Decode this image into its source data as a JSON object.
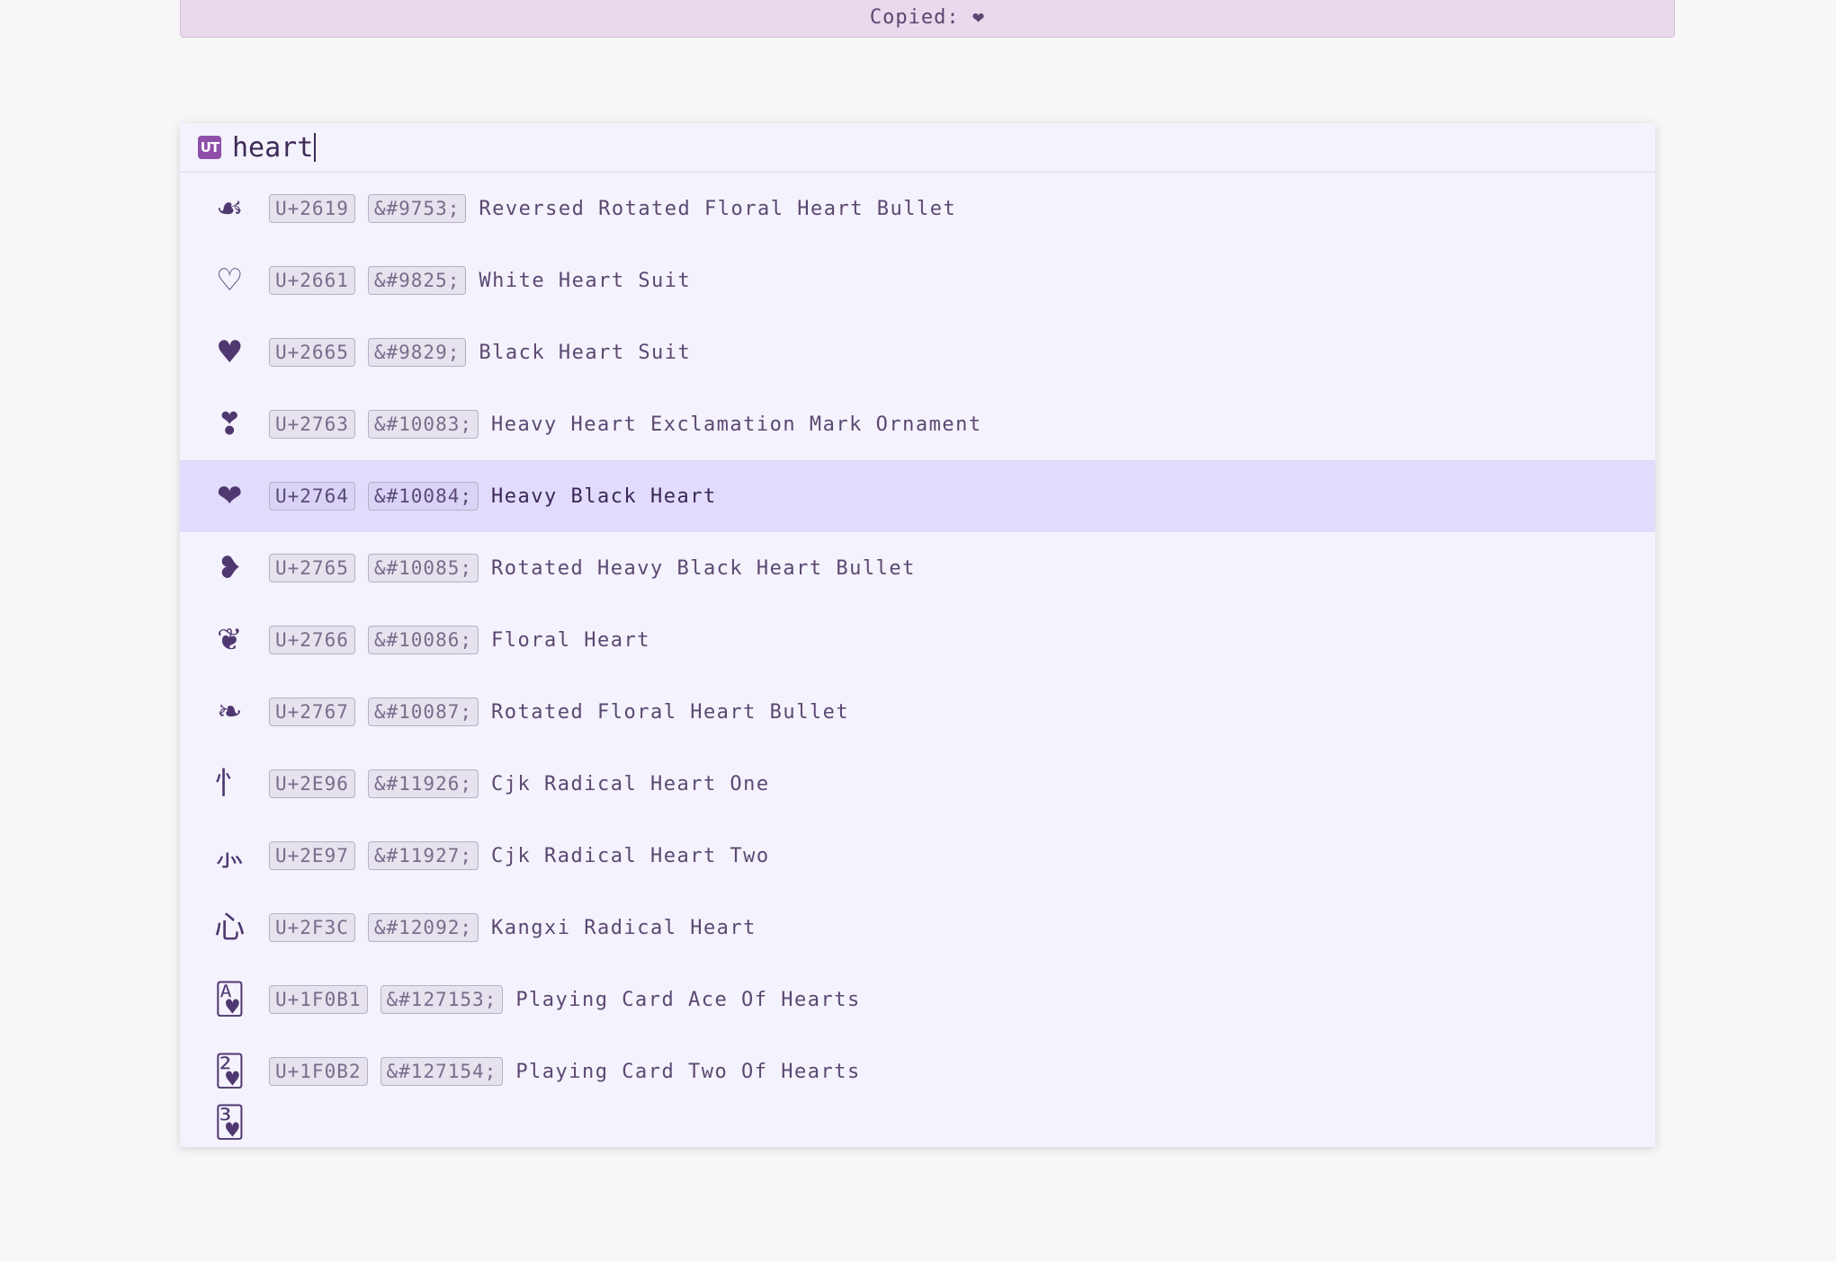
{
  "banner": {
    "label": "Copied:",
    "glyph": "❤"
  },
  "search": {
    "logo_text": "UT",
    "value": "heart"
  },
  "results": [
    {
      "glyph": "☙",
      "code": "U+2619",
      "entity": "&#9753;",
      "name": "Reversed Rotated Floral Heart Bullet"
    },
    {
      "glyph": "♡",
      "code": "U+2661",
      "entity": "&#9825;",
      "name": "White Heart Suit"
    },
    {
      "glyph": "♥",
      "code": "U+2665",
      "entity": "&#9829;",
      "name": "Black Heart Suit"
    },
    {
      "glyph": "❣",
      "code": "U+2763",
      "entity": "&#10083;",
      "name": "Heavy Heart Exclamation Mark Ornament"
    },
    {
      "glyph": "❤",
      "code": "U+2764",
      "entity": "&#10084;",
      "name": "Heavy Black Heart",
      "selected": true
    },
    {
      "glyph": "❥",
      "code": "U+2765",
      "entity": "&#10085;",
      "name": "Rotated Heavy Black Heart Bullet"
    },
    {
      "glyph": "❦",
      "code": "U+2766",
      "entity": "&#10086;",
      "name": "Floral Heart"
    },
    {
      "glyph": "❧",
      "code": "U+2767",
      "entity": "&#10087;",
      "name": "Rotated Floral Heart Bullet"
    },
    {
      "glyph": "⺖",
      "code": "U+2E96",
      "entity": "&#11926;",
      "name": "Cjk Radical Heart One"
    },
    {
      "glyph": "⺗",
      "code": "U+2E97",
      "entity": "&#11927;",
      "name": "Cjk Radical Heart Two"
    },
    {
      "glyph": "⼼",
      "code": "U+2F3C",
      "entity": "&#12092;",
      "name": "Kangxi Radical Heart"
    },
    {
      "glyph": "🂱",
      "code": "U+1F0B1",
      "entity": "&#127153;",
      "name": "Playing Card Ace Of Hearts"
    },
    {
      "glyph": "🂲",
      "code": "U+1F0B2",
      "entity": "&#127154;",
      "name": "Playing Card Two Of Hearts"
    },
    {
      "glyph": "🂳",
      "code": "",
      "entity": "",
      "name": ""
    }
  ],
  "colors": {
    "banner_bg": "#e9d9ec",
    "panel_bg": "#f4f2fc",
    "selected_bg": "#e1dcfb",
    "logo_bg": "#8e4fa8"
  }
}
